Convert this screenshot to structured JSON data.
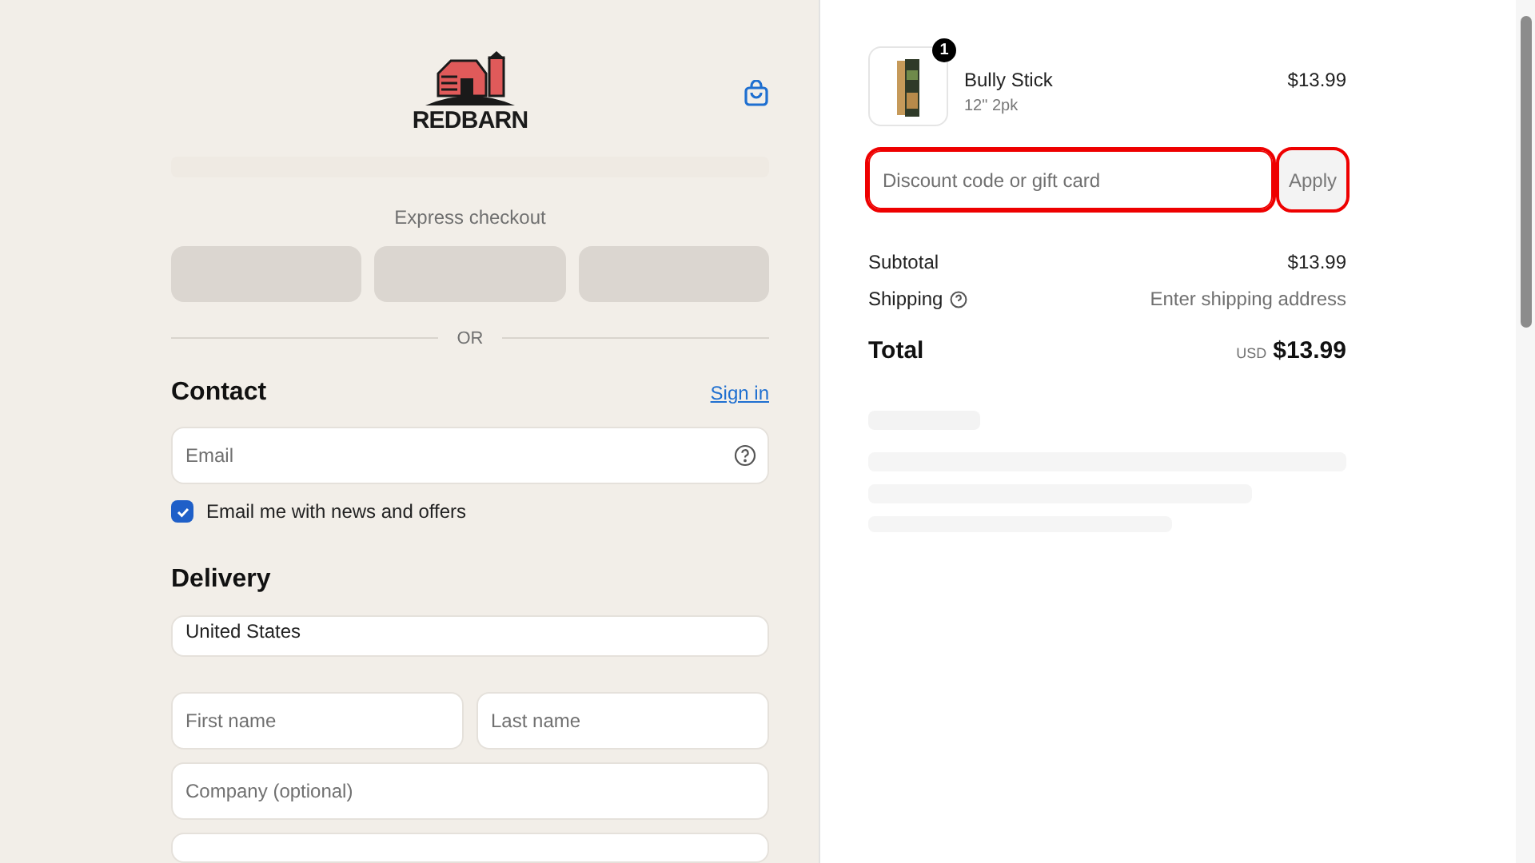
{
  "logo": {
    "text": "REDBARN"
  },
  "express": {
    "label": "Express checkout",
    "divider": "OR"
  },
  "contact": {
    "title": "Contact",
    "sign_in": "Sign in",
    "email": {
      "placeholder": "Email"
    },
    "newsletter": {
      "label": "Email me with news and offers",
      "checked": true
    }
  },
  "delivery": {
    "title": "Delivery",
    "country": {
      "value": "United States"
    },
    "fields": [
      {
        "placeholder": "First name"
      },
      {
        "placeholder": "Last name"
      },
      {
        "placeholder": "Company (optional)"
      }
    ]
  },
  "cart": {
    "items": [
      {
        "name": "Bully Stick",
        "variant": "12\" 2pk",
        "price": "$13.99",
        "quantity": "1"
      }
    ],
    "discount": {
      "placeholder": "Discount code or gift card",
      "button": "Apply",
      "highlighted": true
    },
    "summary": [
      {
        "label": "Subtotal",
        "value": "$13.99",
        "muted": false,
        "info": false
      },
      {
        "label": "Shipping",
        "value": "Enter shipping address",
        "muted": true,
        "info": true
      }
    ],
    "total": {
      "label": "Total",
      "currency": "USD",
      "value": "$13.99"
    }
  }
}
